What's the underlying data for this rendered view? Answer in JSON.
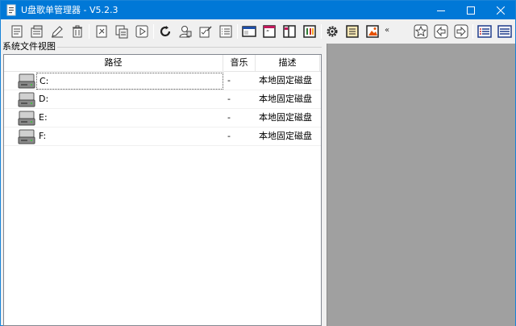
{
  "window": {
    "title": "U盘歌单管理器 - V5.2.3",
    "accent": "#0078d7"
  },
  "toolbar": {
    "icons": [
      "new-playlist-icon",
      "open-playlist-icon",
      "edit-icon",
      "delete-icon",
      "clip-icon",
      "copy-icon",
      "play-icon",
      "refresh-icon",
      "user-icon",
      "check-edit-icon",
      "list-icon",
      "window-icon",
      "quote-icon",
      "split-view-icon",
      "color-bars-icon",
      "gear-icon",
      "notes-icon",
      "image-icon",
      "star-icon",
      "back-icon",
      "forward-icon",
      "details-icon",
      "list-view-icon"
    ],
    "overflow_label": "«"
  },
  "group": {
    "label": "系统文件视图"
  },
  "list": {
    "columns": [
      "路径",
      "音乐",
      "描述"
    ],
    "rows": [
      {
        "path": "C:",
        "music": "-",
        "desc": "本地固定磁盘"
      },
      {
        "path": "D:",
        "music": "-",
        "desc": "本地固定磁盘"
      },
      {
        "path": "E:",
        "music": "-",
        "desc": "本地固定磁盘"
      },
      {
        "path": "F:",
        "music": "-",
        "desc": "本地固定磁盘"
      }
    ]
  }
}
